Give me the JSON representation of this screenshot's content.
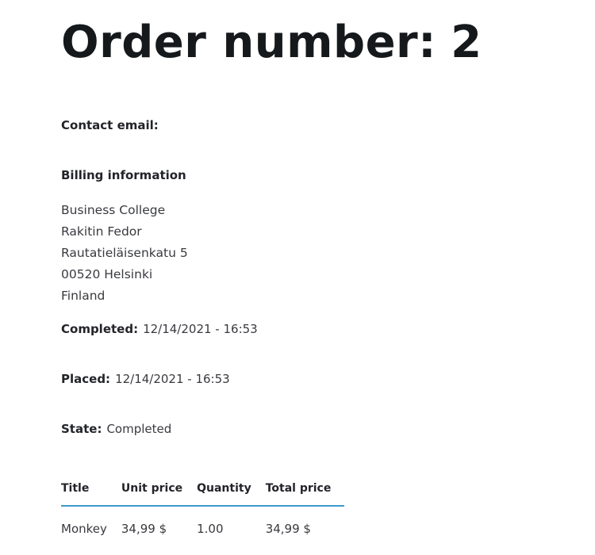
{
  "order": {
    "title_label": "Order number:",
    "number": "2"
  },
  "contact": {
    "label": "Contact email:",
    "value": ""
  },
  "billing": {
    "title": "Billing information",
    "lines": [
      "Business College",
      "Rakitin Fedor",
      "Rautatieläisenkatu 5",
      "00520 Helsinki",
      "Finland"
    ]
  },
  "completed": {
    "label": "Completed:",
    "value": "12/14/2021 - 16:53"
  },
  "placed": {
    "label": "Placed:",
    "value": "12/14/2021 - 16:53"
  },
  "state": {
    "label": "State:",
    "value": "Completed"
  },
  "items_table": {
    "headers": [
      "Title",
      "Unit price",
      "Quantity",
      "Total price"
    ],
    "rows": [
      [
        "Monkey",
        "34,99 $",
        "1.00",
        "34,99 $"
      ]
    ],
    "accent_color": "#3d9bc7"
  }
}
